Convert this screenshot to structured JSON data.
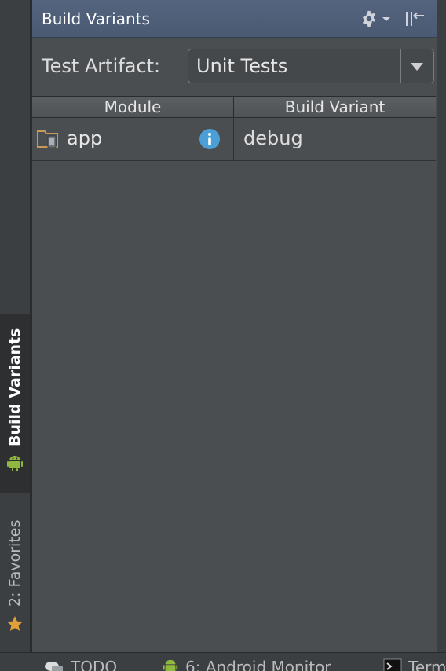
{
  "panel": {
    "title": "Build Variants"
  },
  "test_artifact": {
    "label": "Test Artifact:",
    "selected": "Unit Tests"
  },
  "table": {
    "headers": [
      "Module",
      "Build Variant"
    ],
    "rows": [
      {
        "module": "app",
        "variant": "debug"
      }
    ]
  },
  "left_tabs": [
    {
      "label": "Build Variants",
      "icon": "android-icon",
      "active": true
    },
    {
      "label": "2: Favorites",
      "icon": "star-icon",
      "active": false
    }
  ],
  "bottom_tabs": [
    {
      "label": "TODO",
      "icon": "todo-icon"
    },
    {
      "label": "6: Android Monitor",
      "icon": "android-icon"
    },
    {
      "label": "Term",
      "icon": "terminal-icon"
    }
  ],
  "colors": {
    "header_bg": "#4f5f79",
    "panel_bg": "#4b4e51",
    "android_green": "#8fb93e",
    "info_blue": "#4a9fd6",
    "star_orange": "#e0a13a"
  }
}
